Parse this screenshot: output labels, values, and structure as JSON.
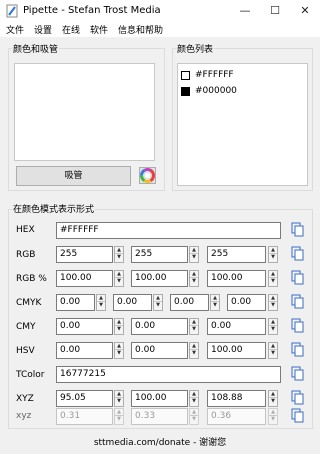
{
  "window": {
    "title": "Pipette - Stefan Trost Media",
    "minimize": "—",
    "maximize": "☐",
    "close": "✕"
  },
  "menu": [
    "文件",
    "设置",
    "在线",
    "软件",
    "信息和帮助"
  ],
  "pickerGroup": {
    "label": "颜色和吸管",
    "pipetteButton": "吸管"
  },
  "listGroup": {
    "label": "颜色列表",
    "items": [
      {
        "hex": "#FFFFFF",
        "swatch": "#FFFFFF"
      },
      {
        "hex": "#000000",
        "swatch": "#000000"
      }
    ]
  },
  "modelsGroup": {
    "label": "在颜色模式表示形式"
  },
  "models": {
    "hex": {
      "label": "HEX",
      "value": "#FFFFFF"
    },
    "rgb": {
      "label": "RGB",
      "values": [
        "255",
        "255",
        "255"
      ]
    },
    "rgbp": {
      "label": "RGB %",
      "values": [
        "100.00",
        "100.00",
        "100.00"
      ]
    },
    "cmyk": {
      "label": "CMYK",
      "values": [
        "0.00",
        "0.00",
        "0.00",
        "0.00"
      ]
    },
    "cmy": {
      "label": "CMY",
      "values": [
        "0.00",
        "0.00",
        "0.00"
      ]
    },
    "hsv": {
      "label": "HSV",
      "values": [
        "0.00",
        "0.00",
        "100.00"
      ]
    },
    "tcolor": {
      "label": "TColor",
      "value": "16777215"
    },
    "xyz": {
      "label": "XYZ",
      "values": [
        "95.05",
        "100.00",
        "108.88"
      ]
    },
    "xyzs": {
      "label": "xyz",
      "values": [
        "0.31",
        "0.33",
        "0.36"
      ]
    }
  },
  "footer": "sttmedia.com/donate - 谢谢您",
  "colors": {
    "accent": "#2b74d8",
    "titlebarBg": "#ffffff",
    "windowBg": "#f0f0f0"
  },
  "icons": [
    "app-pipette-icon",
    "color-wheel-icon",
    "copy-icon",
    "spin-up-icon",
    "spin-down-icon"
  ]
}
